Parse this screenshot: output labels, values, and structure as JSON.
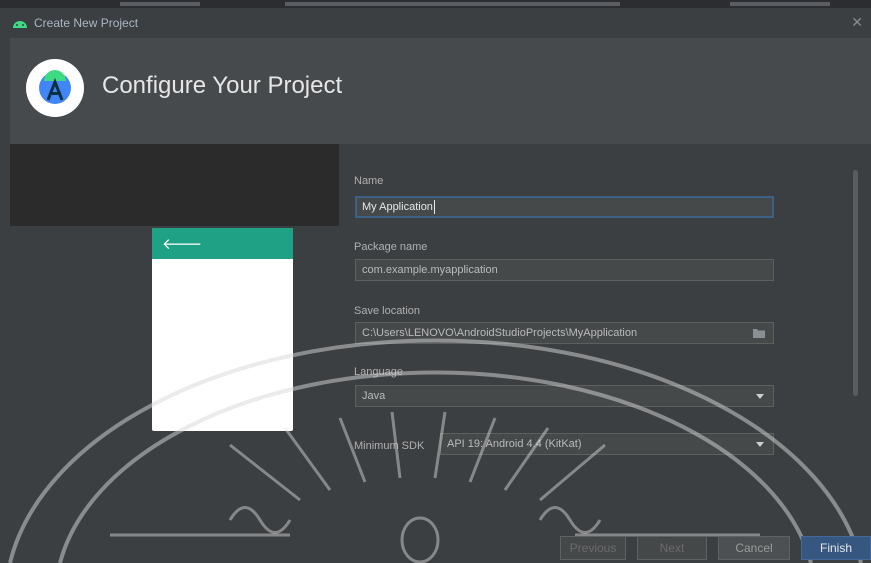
{
  "window": {
    "title": "Create New Project",
    "close_glyph": "✕"
  },
  "header": {
    "heading": "Configure Your Project",
    "icon": "android-studio-icon"
  },
  "preview": {
    "back_glyph": "🡐"
  },
  "form": {
    "name_label": "Name",
    "name_value": "My Application",
    "package_label": "Package name",
    "package_value": "com.example.myapplication",
    "save_label": "Save location",
    "save_value": "C:\\Users\\LENOVO\\AndroidStudioProjects\\MyApplication",
    "language_label": "Language",
    "language_value": "Java",
    "sdk_label": "Minimum SDK",
    "sdk_value": "API 19: Android 4.4 (KitKat)"
  },
  "buttons": {
    "previous": "Previous",
    "next": "Next",
    "cancel": "Cancel",
    "finish": "Finish"
  },
  "colors": {
    "accent": "#1ea184",
    "focus_border": "#3d6185",
    "primary_button": "#365880"
  }
}
